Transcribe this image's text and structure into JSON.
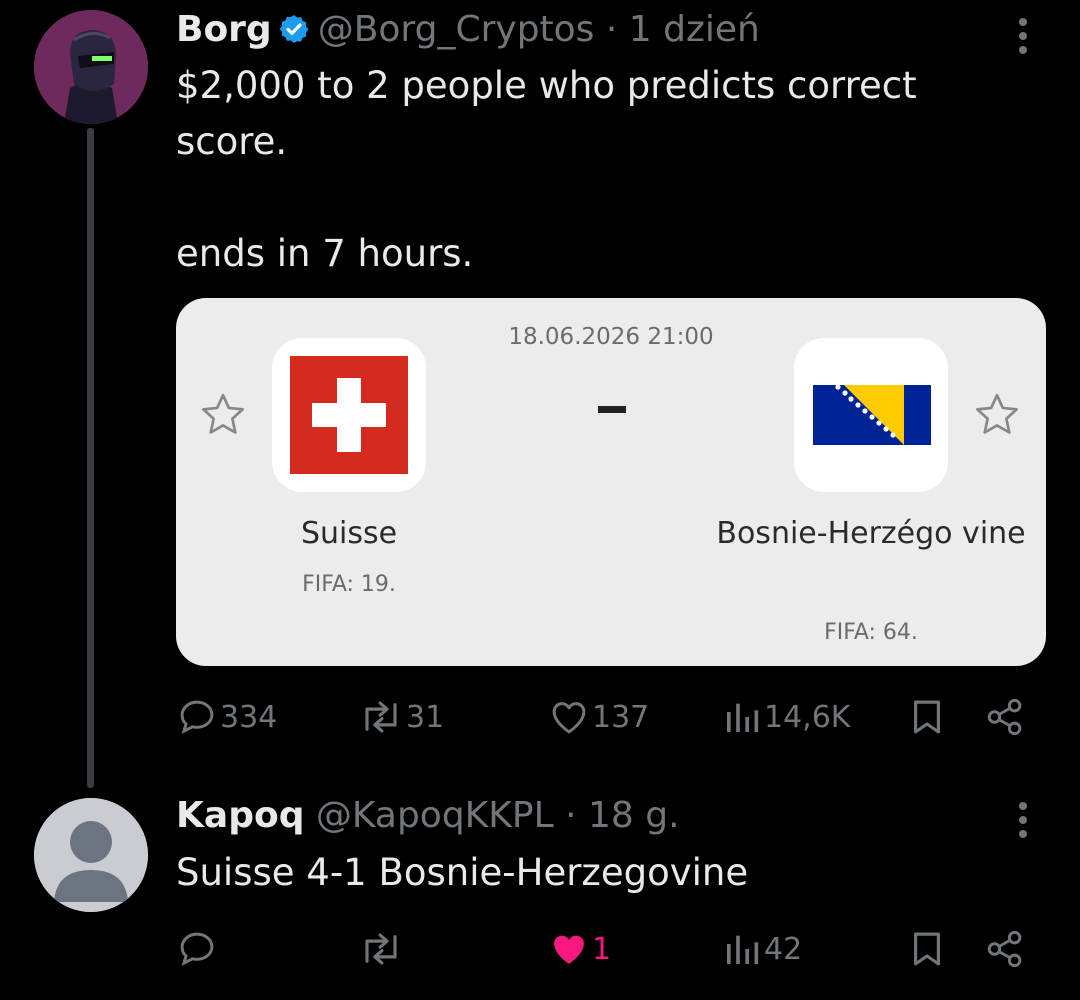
{
  "post": {
    "author_name": "Borg",
    "handle": "@Borg_Cryptos",
    "separator": "·",
    "time": "1 dzień",
    "text_line_1": "$2,000 to 2 people who predicts correct score.",
    "text_line_2": "ends in 7 hours.",
    "match_card": {
      "datetime": "18.06.2026 21:00",
      "home_team": "Suisse",
      "home_fifa": "FIFA: 19.",
      "away_team": "Bosnie-Herzégo vine",
      "away_fifa": "FIFA: 64."
    },
    "stats": {
      "replies": "334",
      "reposts": "31",
      "likes": "137",
      "views": "14,6K"
    }
  },
  "reply": {
    "author_name": "Kapoq",
    "handle": "@KapoqKKPL",
    "separator": "·",
    "time": "18 g.",
    "text": "Suisse 4-1 Bosnie-Herzegovine",
    "stats": {
      "likes": "1",
      "views": "42"
    }
  },
  "colors": {
    "background": "#000000",
    "muted_text": "#71767b",
    "verified_blue": "#1d9bf0",
    "like_pink": "#f91880",
    "swiss_red": "#d52b1e",
    "bosnia_blue": "#002395",
    "bosnia_yellow": "#fecb00"
  },
  "icons": [
    "reply-icon",
    "repost-icon",
    "like-icon",
    "views-icon",
    "bookmark-icon",
    "share-icon",
    "more-icon",
    "star-icon",
    "verified-badge-icon"
  ]
}
